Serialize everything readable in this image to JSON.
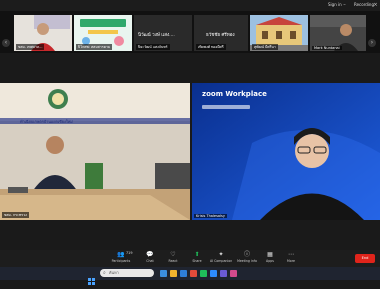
{
  "topbar": {
    "sign_label": "Sign in",
    "recording_label": "Recording"
  },
  "gallery": {
    "tiles": [
      {
        "label": "ขสม. เทศบาล..."
      },
      {
        "label": "ปิโกศพ: สสมสารคาม",
        "name": "นิวัฒน์ วงษ์ แสง...."
      },
      {
        "label": "ปิยะวัฒน์ แสงจันทร์"
      },
      {
        "label": "เทิดพงศ์ ทองมีศรี",
        "name": "ธวัชชัย ศรีทอง"
      },
      {
        "label": "สุพัฒน์ มีศรีนา"
      },
      {
        "label": "Mark Nuntanai"
      }
    ]
  },
  "main": {
    "left_label": "ขสม. กระทรวง",
    "left_banner": "ทำเนียบเกษตรบ้านแยกเชียงใหม่",
    "zoom_brand": "zoom Workplace",
    "right_label": "Krisis Thalesalsy"
  },
  "toolbar": {
    "items": [
      {
        "icon": "people-icon",
        "label": "Participants",
        "count": "719"
      },
      {
        "icon": "chat-icon",
        "label": "Chat"
      },
      {
        "icon": "react-icon",
        "label": "React"
      },
      {
        "icon": "share-icon",
        "label": "Share"
      },
      {
        "icon": "ai-companion-icon",
        "label": "AI Companion"
      },
      {
        "icon": "meeting-info-icon",
        "label": "Meeting info"
      },
      {
        "icon": "apps-icon",
        "label": "Apps"
      },
      {
        "icon": "more-icon",
        "label": "More"
      }
    ],
    "end_label": "End"
  },
  "taskbar": {
    "search_placeholder": "ค้นหา"
  },
  "colors": {
    "end_red": "#e0241b",
    "share_green": "#1fbf5a",
    "zoom_blue": "#0b2a7a"
  }
}
